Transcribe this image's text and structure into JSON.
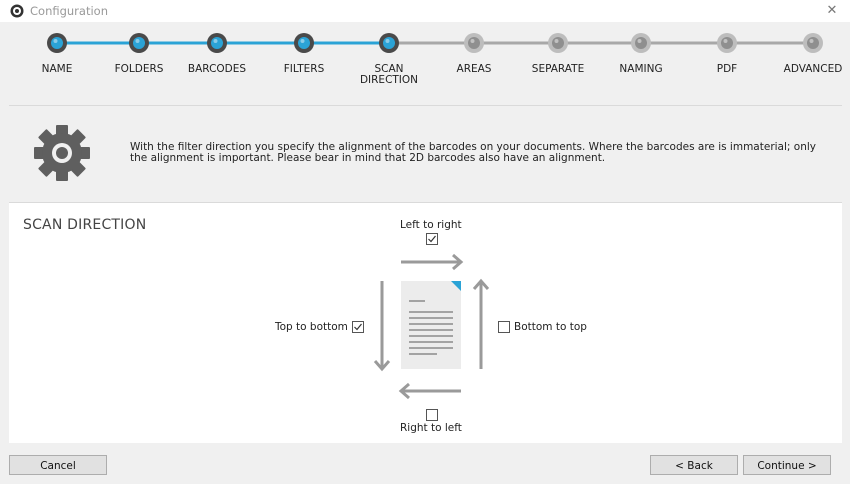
{
  "window": {
    "title": "Configuration",
    "close_glyph": "✕"
  },
  "wizard": {
    "active_color": "#2ba3d6",
    "inactive_color": "#a8a8a8",
    "current_step_index": 4,
    "steps": [
      {
        "label": "NAME",
        "state": "completed"
      },
      {
        "label": "FOLDERS",
        "state": "completed"
      },
      {
        "label": "BARCODES",
        "state": "completed"
      },
      {
        "label": "FILTERS",
        "state": "completed"
      },
      {
        "label": "SCAN DIRECTION",
        "state": "current"
      },
      {
        "label": "AREAS",
        "state": "pending"
      },
      {
        "label": "SEPARATE",
        "state": "pending"
      },
      {
        "label": "NAMING",
        "state": "pending"
      },
      {
        "label": "PDF",
        "state": "pending"
      },
      {
        "label": "ADVANCED",
        "state": "pending"
      }
    ]
  },
  "info": {
    "icon": "gear-icon",
    "text": "With the filter direction you specify the alignment of the barcodes on your documents. Where the barcodes are is immaterial; only the alignment is important. Please bear in mind that 2D barcodes also have an alignment."
  },
  "scan_direction": {
    "title": "SCAN DIRECTION",
    "options": {
      "left_to_right": {
        "label": "Left to right",
        "checked": true
      },
      "top_to_bottom": {
        "label": "Top to bottom",
        "checked": true
      },
      "bottom_to_top": {
        "label": "Bottom to top",
        "checked": false
      },
      "right_to_left": {
        "label": "Right to left",
        "checked": false
      }
    }
  },
  "buttons": {
    "cancel": "Cancel",
    "back": "< Back",
    "continue": "Continue >"
  }
}
